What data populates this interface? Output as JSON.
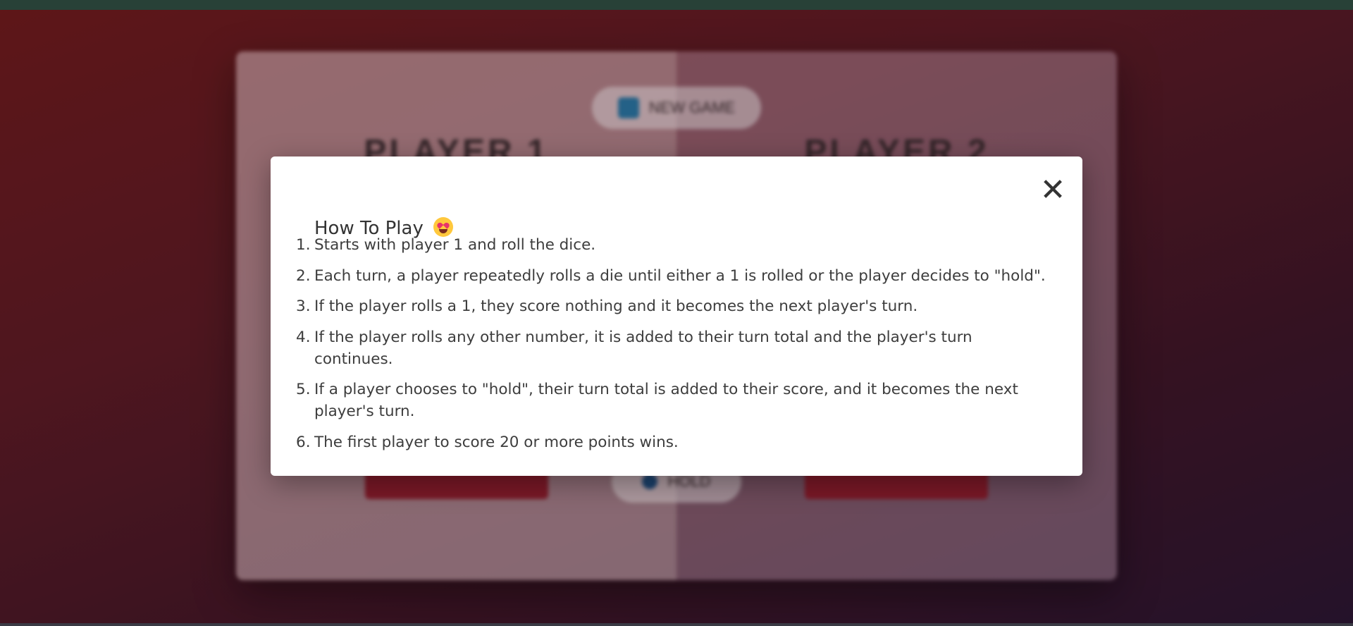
{
  "background": {
    "player1_name": "PLAYER 1",
    "player2_name": "PLAYER 2",
    "new_game_label": "NEW GAME",
    "hold_label": "HOLD"
  },
  "modal": {
    "close_symbol": "✕",
    "title": "How To Play",
    "title_emoji": "smiling-face-with-heart-eyes-icon",
    "rules": [
      "Starts with player 1 and roll the dice.",
      "Each turn, a player repeatedly rolls a die until either a 1 is rolled or the player decides to \"hold\".",
      "If the player rolls a 1, they score nothing and it becomes the next player's turn.",
      "If the player rolls any other number, it is added to their turn total and the player's turn continues.",
      "If a player chooses to \"hold\", their turn total is added to their score, and it becomes the next player's turn.",
      "The first player to score 20 or more points wins."
    ]
  },
  "colors": {
    "backdrop_start": "#6b1a1c",
    "backdrop_end": "#2a1530",
    "topbar": "#2e4a3f",
    "modal_bg": "#ffffff",
    "text": "#3d3d3d"
  }
}
